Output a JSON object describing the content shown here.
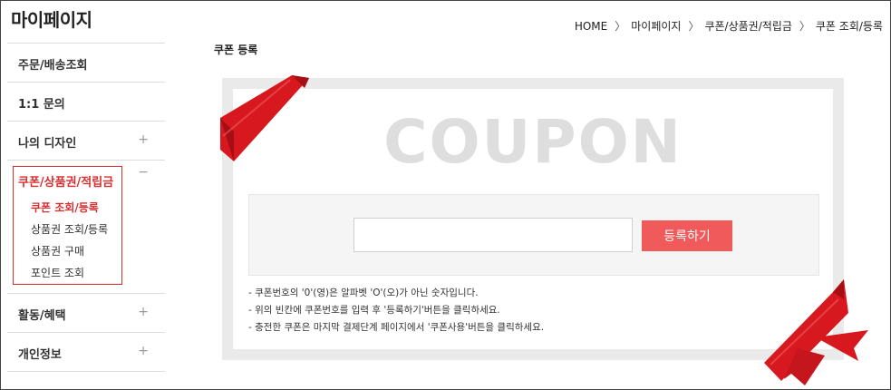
{
  "sidebar": {
    "title": "마이페이지",
    "items": [
      {
        "label": "주문/배송조회",
        "toggle": ""
      },
      {
        "label": "1:1 문의",
        "toggle": ""
      },
      {
        "label": "나의 디자인",
        "toggle": "+"
      }
    ],
    "open_section": {
      "label": "쿠폰/상품권/적립금",
      "toggle": "−",
      "subitems": [
        "쿠폰 조회/등록",
        "상품권 조회/등록",
        "상품권 구매",
        "포인트 조회"
      ]
    },
    "items_after": [
      {
        "label": "활동/혜택",
        "toggle": "+"
      },
      {
        "label": "개인정보",
        "toggle": "+"
      }
    ]
  },
  "breadcrumb": [
    "HOME",
    "마이페이지",
    "쿠폰/상품권/적립금",
    "쿠폰 조회/등록"
  ],
  "breadcrumb_sep": "〉",
  "page_title": "쿠폰 등록",
  "coupon": {
    "word": "COUPON",
    "input_value": "",
    "input_placeholder": "",
    "button_label": "등록하기",
    "notes": [
      "- 쿠폰번호의 '0'(영)은 알파벳 'O'(오)가 아닌 숫자입니다.",
      "- 위의 빈칸에 쿠폰번호를 입력 후 '등록하기'버튼을 클릭하세요.",
      "- 충전한 쿠폰은 마지막 결제단계 페이지에서 '쿠폰사용'버튼을 클릭하세요."
    ]
  },
  "colors": {
    "accent_red": "#d9302f",
    "button_red": "#f05a5a",
    "ribbon_red": "#d7191f"
  }
}
